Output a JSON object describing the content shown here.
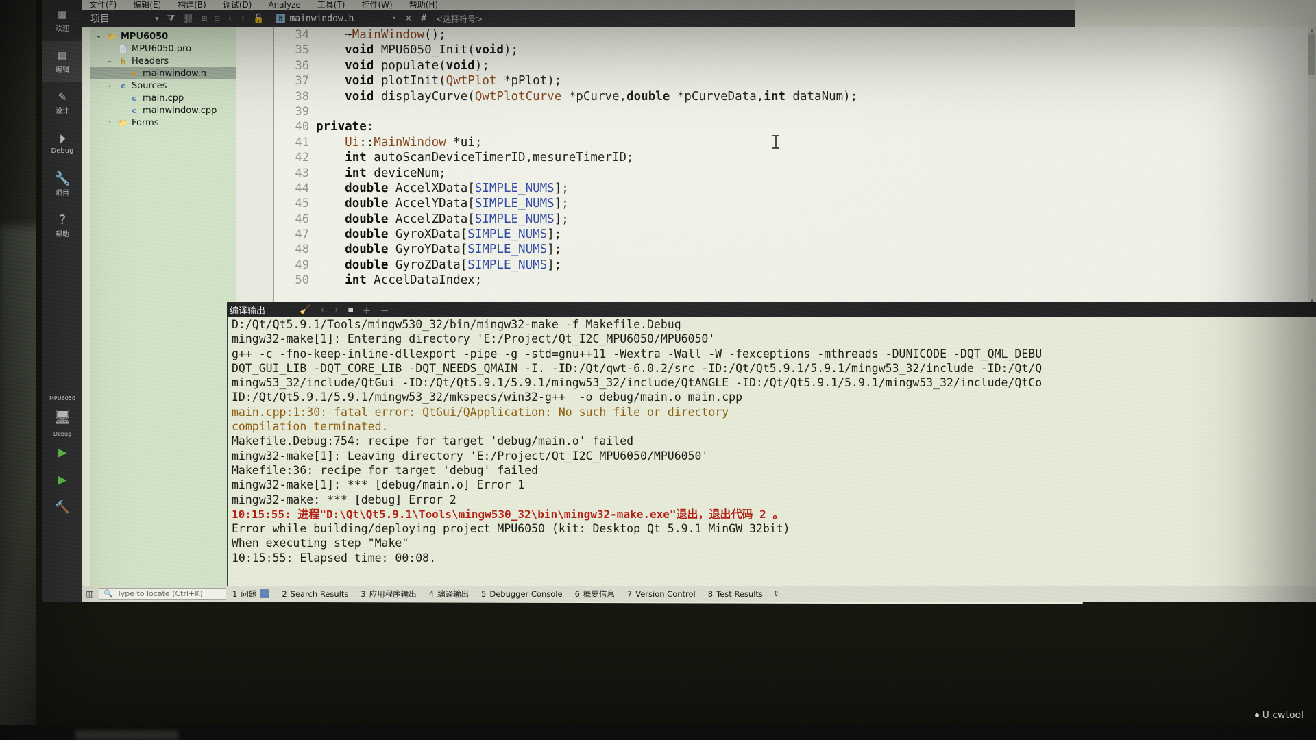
{
  "menubar": {
    "items": [
      "文件(F)",
      "编辑(E)",
      "构建(B)",
      "调试(D)",
      "Analyze",
      "工具(T)",
      "控件(W)",
      "帮助(H)"
    ]
  },
  "project_pane": {
    "title": "项目",
    "icons": [
      "chevron-down-icon",
      "filter-icon",
      "link-icon",
      "split-icon",
      "box-icon",
      "back-icon",
      "forward-icon",
      "lock-icon"
    ]
  },
  "editor_tab": {
    "badge": "h",
    "filename": "mainwindow.h",
    "caret": "▾",
    "close": "×",
    "hash": "#",
    "symbol_selector": "<选择符号>"
  },
  "modebar": {
    "items": [
      {
        "glyph": "▦",
        "label": "欢迎"
      },
      {
        "glyph": "▤",
        "label": "编辑"
      },
      {
        "glyph": "✎",
        "label": "设计"
      },
      {
        "glyph": "⏵",
        "label": "Debug"
      },
      {
        "glyph": "🔧",
        "label": "项目"
      },
      {
        "glyph": "?",
        "label": "帮助"
      }
    ],
    "run_target_name": "MPU6050",
    "run_target_config": "Debug",
    "kit_icon": "computer-icon",
    "run_icon": "▶",
    "debug_icon": "▶",
    "build_icon": "🔨"
  },
  "project_tree": [
    {
      "depth": 0,
      "arrow": "⌄",
      "icon": "folder",
      "label": "MPU6050",
      "bold": true,
      "selected": false
    },
    {
      "depth": 1,
      "arrow": "",
      "icon": "pro",
      "label": "MPU6050.pro",
      "bold": false,
      "selected": false
    },
    {
      "depth": 1,
      "arrow": "⌄",
      "icon": "h",
      "label": "Headers",
      "bold": false,
      "selected": false
    },
    {
      "depth": 2,
      "arrow": "",
      "icon": "h",
      "label": "mainwindow.h",
      "bold": false,
      "selected": true
    },
    {
      "depth": 1,
      "arrow": "⌄",
      "icon": "cpp",
      "label": "Sources",
      "bold": false,
      "selected": false
    },
    {
      "depth": 2,
      "arrow": "",
      "icon": "cpp",
      "label": "main.cpp",
      "bold": false,
      "selected": false
    },
    {
      "depth": 2,
      "arrow": "",
      "icon": "cpp",
      "label": "mainwindow.cpp",
      "bold": false,
      "selected": false
    },
    {
      "depth": 1,
      "arrow": "›",
      "icon": "folder",
      "label": "Forms",
      "bold": false,
      "selected": false
    }
  ],
  "code": {
    "first_line_number": 34,
    "lines": [
      {
        "n": 34,
        "text": "    ~MainWindow();"
      },
      {
        "n": 35,
        "text": "    void MPU6050_Init(void);"
      },
      {
        "n": 36,
        "text": "    void populate(void);"
      },
      {
        "n": 37,
        "text": "    void plotInit(QwtPlot *pPlot);"
      },
      {
        "n": 38,
        "text": "    void displayCurve(QwtPlotCurve *pCurve,double *pCurveData,int dataNum);"
      },
      {
        "n": 39,
        "text": ""
      },
      {
        "n": 40,
        "text": "private:"
      },
      {
        "n": 41,
        "text": "    Ui::MainWindow *ui;"
      },
      {
        "n": 42,
        "text": "    int autoScanDeviceTimerID,mesureTimerID;"
      },
      {
        "n": 43,
        "text": "    int deviceNum;"
      },
      {
        "n": 44,
        "text": "    double AccelXData[SIMPLE_NUMS];"
      },
      {
        "n": 45,
        "text": "    double AccelYData[SIMPLE_NUMS];"
      },
      {
        "n": 46,
        "text": "    double AccelZData[SIMPLE_NUMS];"
      },
      {
        "n": 47,
        "text": "    double GyroXData[SIMPLE_NUMS];"
      },
      {
        "n": 48,
        "text": "    double GyroYData[SIMPLE_NUMS];"
      },
      {
        "n": 49,
        "text": "    double GyroZData[SIMPLE_NUMS];"
      },
      {
        "n": 50,
        "text": "    int AccelDataIndex;"
      }
    ]
  },
  "output_pane": {
    "title": "编译输出",
    "icons": [
      "clear-icon",
      "prev-icon",
      "next-icon",
      "stop-icon",
      "zoom-in-icon",
      "zoom-out-icon"
    ],
    "lines": [
      {
        "style": "normal",
        "text": "D:/Qt/Qt5.9.1/Tools/mingw530_32/bin/mingw32-make -f Makefile.Debug"
      },
      {
        "style": "normal",
        "text": "mingw32-make[1]: Entering directory 'E:/Project/Qt_I2C_MPU6050/MPU6050'"
      },
      {
        "style": "normal",
        "text": "g++ -c -fno-keep-inline-dllexport -pipe -g -std=gnu++11 -Wextra -Wall -W -fexceptions -mthreads -DUNICODE -DQT_QML_DEBU"
      },
      {
        "style": "normal",
        "text": "DQT_GUI_LIB -DQT_CORE_LIB -DQT_NEEDS_QMAIN -I. -ID:/Qt/qwt-6.0.2/src -ID:/Qt/Qt5.9.1/5.9.1/mingw53_32/include -ID:/Qt/Q"
      },
      {
        "style": "normal",
        "text": "mingw53_32/include/QtGui -ID:/Qt/Qt5.9.1/5.9.1/mingw53_32/include/QtANGLE -ID:/Qt/Qt5.9.1/5.9.1/mingw53_32/include/QtCo"
      },
      {
        "style": "normal",
        "text": "ID:/Qt/Qt5.9.1/5.9.1/mingw53_32/mkspecs/win32-g++  -o debug/main.o main.cpp"
      },
      {
        "style": "err",
        "text": "main.cpp:1:30: fatal error: QtGui/QApplication: No such file or directory"
      },
      {
        "style": "err",
        "text": "compilation terminated."
      },
      {
        "style": "normal",
        "text": "Makefile.Debug:754: recipe for target 'debug/main.o' failed"
      },
      {
        "style": "normal",
        "text": "mingw32-make[1]: Leaving directory 'E:/Project/Qt_I2C_MPU6050/MPU6050'"
      },
      {
        "style": "normal",
        "text": "Makefile:36: recipe for target 'debug' failed"
      },
      {
        "style": "normal",
        "text": "mingw32-make[1]: *** [debug/main.o] Error 1"
      },
      {
        "style": "normal",
        "text": "mingw32-make: *** [debug] Error 2"
      },
      {
        "style": "red",
        "text": "10:15:55: 进程\"D:\\Qt\\Qt5.9.1\\Tools\\mingw530_32\\bin\\mingw32-make.exe\"退出，退出代码 2 。"
      },
      {
        "style": "normal",
        "text": "Error while building/deploying project MPU6050 (kit: Desktop Qt 5.9.1 MinGW 32bit)"
      },
      {
        "style": "normal",
        "text": "When executing step \"Make\""
      },
      {
        "style": "normal",
        "text": "10:15:55: Elapsed time: 00:08."
      }
    ]
  },
  "statusbar": {
    "locator_placeholder": "Type to locate (Ctrl+K)",
    "search_icon": "search-icon",
    "items": [
      {
        "num": "1",
        "label": "问题",
        "badge": "1"
      },
      {
        "num": "2",
        "label": "Search Results",
        "badge": ""
      },
      {
        "num": "3",
        "label": "应用程序输出",
        "badge": ""
      },
      {
        "num": "4",
        "label": "编译输出",
        "badge": ""
      },
      {
        "num": "5",
        "label": "Debugger Console",
        "badge": ""
      },
      {
        "num": "6",
        "label": "概要信息",
        "badge": ""
      },
      {
        "num": "7",
        "label": "Version Control",
        "badge": ""
      },
      {
        "num": "8",
        "label": "Test Results",
        "badge": ""
      }
    ],
    "updown": "⇕"
  },
  "watermark": {
    "text": "U cwtool"
  },
  "colors": {
    "editor_bg": "#eff0e6",
    "tree_bg": "#cfe0c2",
    "output_bg": "#e4e9d4",
    "panel_dark": "#2d2d2d",
    "error_red": "#b01d12",
    "error_orange": "#8a5a10",
    "run_green": "#5fc24a",
    "badge_blue": "#5d7fae"
  }
}
